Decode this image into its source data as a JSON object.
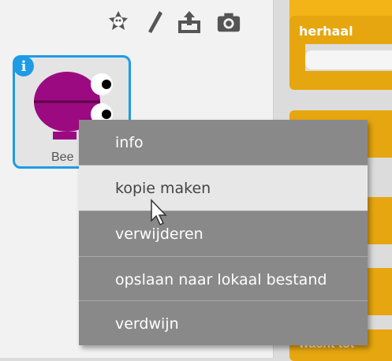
{
  "toolbar": {
    "icons": [
      "paint-new-sprite-icon",
      "pencil-icon",
      "upload-sprite-icon",
      "camera-icon"
    ]
  },
  "sprite": {
    "name": "Bee",
    "info_icon": "i"
  },
  "scripts": {
    "repeat_label": "herhaal",
    "wait_label": "wacht tot"
  },
  "context_menu": {
    "items": [
      "info",
      "kopie maken",
      "verwijderen",
      "opslaan naar lokaal bestand",
      "verdwijn"
    ],
    "hovered": "kopie maken"
  },
  "colors": {
    "selection": "#1e9be5",
    "menu_bg": "#898989",
    "menu_hover": "#e7e7e7",
    "control_block": "#e6a60f",
    "sprite": "#9c0a82"
  }
}
